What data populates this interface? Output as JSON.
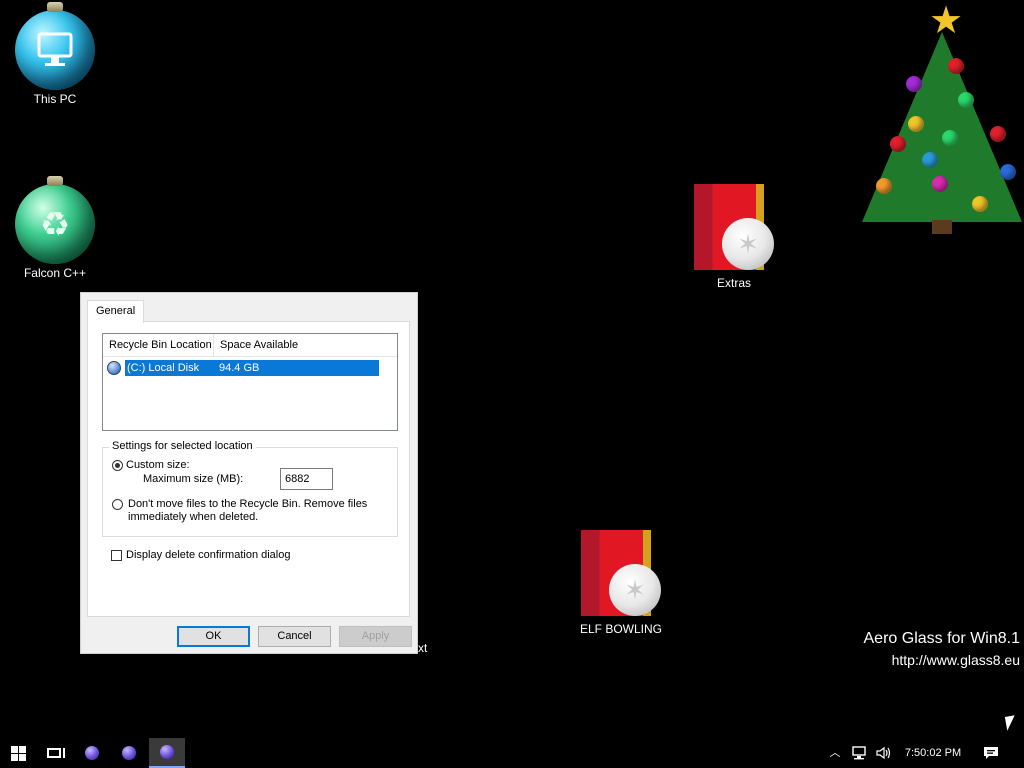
{
  "desktop": {
    "icons": [
      {
        "label": "This PC"
      },
      {
        "label": "Falcon C++"
      },
      {
        "label": "Extras"
      },
      {
        "label": "ELF BOWLING"
      }
    ],
    "partial_label": "xt",
    "watermark": {
      "line1": "Aero Glass for Win8.1",
      "line2": "http://www.glass8.eu"
    }
  },
  "dialog": {
    "tab": "General",
    "list": {
      "columns": [
        "Recycle Bin Location",
        "Space Available"
      ],
      "rows": [
        {
          "location": "(C:) Local Disk",
          "space": "94.4 GB",
          "selected": true
        }
      ]
    },
    "settings_group": "Settings for selected location",
    "custom_size_label": "Custom size:",
    "custom_size_selected": true,
    "max_size_label": "Maximum size (MB):",
    "max_size_value": "6882",
    "dont_move_label": "Don't move files to the Recycle Bin. Remove files immediately when deleted.",
    "confirm_label": "Display delete confirmation dialog",
    "confirm_checked": false,
    "buttons": {
      "ok": "OK",
      "cancel": "Cancel",
      "apply": "Apply"
    }
  },
  "taskbar": {
    "clock": "7:50:02 PM",
    "tray_icons": [
      "chevron-up-icon",
      "network-icon",
      "volume-icon",
      "action-center-icon"
    ]
  },
  "colors": {
    "desktop_bg": "#000000",
    "selection": "#0a78d7"
  }
}
